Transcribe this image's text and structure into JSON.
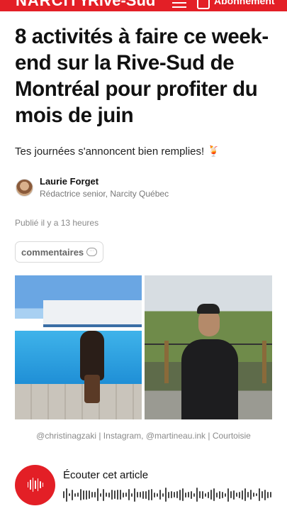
{
  "header": {
    "brand": "NARCITY",
    "section": "Rive-Sud",
    "account_label": "Abonnement"
  },
  "article": {
    "headline": "8 activités à faire ce week-end sur la Rive-Sud de Montréal pour profiter du mois de juin",
    "subhead": "Tes journées s'annoncent bien remplies! 🍹",
    "author": {
      "name": "Laurie Forget",
      "role": "Rédactrice senior, Narcity Québec"
    },
    "published": "Publié il y a 13 heures",
    "comments_label": "commentaires",
    "image_caption": "@christinagzaki | Instagram, @martineau.ink | Courtoisie"
  },
  "audio": {
    "title": "Écouter cet article"
  },
  "colors": {
    "brand_red": "#e31f26"
  }
}
